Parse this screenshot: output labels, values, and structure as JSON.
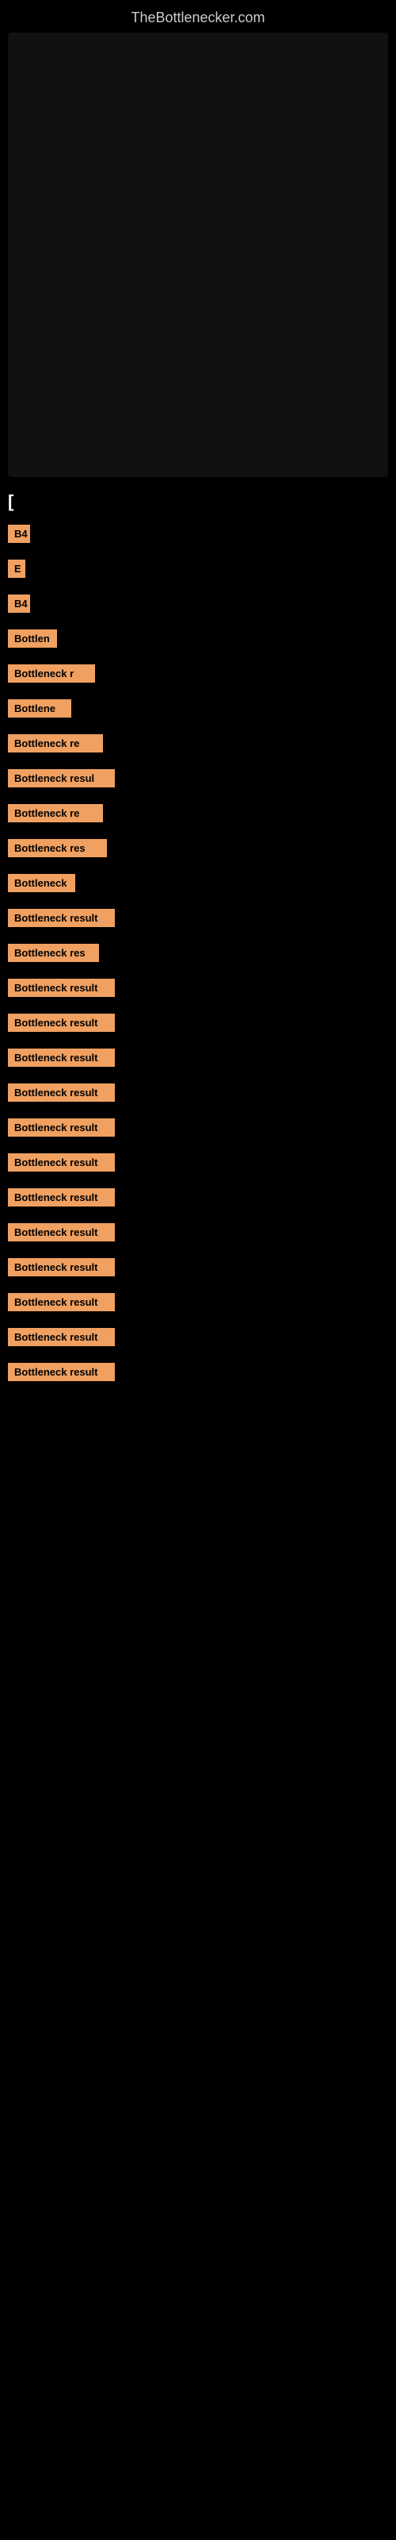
{
  "site": {
    "title": "TheBottlenecker.com"
  },
  "header": {
    "section_label": "["
  },
  "blocks": [
    {
      "id": 1,
      "label": "B4",
      "width_class": "block-1"
    },
    {
      "id": 2,
      "label": "E",
      "width_class": "block-2"
    },
    {
      "id": 3,
      "label": "B4",
      "width_class": "block-3"
    },
    {
      "id": 4,
      "label": "Bottlen",
      "width_class": "block-4"
    },
    {
      "id": 5,
      "label": "Bottleneck r",
      "width_class": "block-5"
    },
    {
      "id": 6,
      "label": "Bottlene",
      "width_class": "block-6"
    },
    {
      "id": 7,
      "label": "Bottleneck re",
      "width_class": "block-7"
    },
    {
      "id": 8,
      "label": "Bottleneck resul",
      "width_class": "block-8"
    },
    {
      "id": 9,
      "label": "Bottleneck re",
      "width_class": "block-9"
    },
    {
      "id": 10,
      "label": "Bottleneck res",
      "width_class": "block-10"
    },
    {
      "id": 11,
      "label": "Bottleneck",
      "width_class": "block-11"
    },
    {
      "id": 12,
      "label": "Bottleneck result",
      "width_class": "block-12"
    },
    {
      "id": 13,
      "label": "Bottleneck res",
      "width_class": "block-13"
    },
    {
      "id": 14,
      "label": "Bottleneck result",
      "width_class": "block-14"
    },
    {
      "id": 15,
      "label": "Bottleneck result",
      "width_class": "block-15"
    },
    {
      "id": 16,
      "label": "Bottleneck result",
      "width_class": "block-16"
    },
    {
      "id": 17,
      "label": "Bottleneck result",
      "width_class": "block-17"
    },
    {
      "id": 18,
      "label": "Bottleneck result",
      "width_class": "block-18"
    },
    {
      "id": 19,
      "label": "Bottleneck result",
      "width_class": "block-19"
    },
    {
      "id": 20,
      "label": "Bottleneck result",
      "width_class": "block-20"
    },
    {
      "id": 21,
      "label": "Bottleneck result",
      "width_class": "block-21"
    },
    {
      "id": 22,
      "label": "Bottleneck result",
      "width_class": "block-22"
    },
    {
      "id": 23,
      "label": "Bottleneck result",
      "width_class": "block-23"
    },
    {
      "id": 24,
      "label": "Bottleneck result",
      "width_class": "block-24"
    },
    {
      "id": 25,
      "label": "Bottleneck result",
      "width_class": "block-25"
    }
  ],
  "colors": {
    "background": "#000000",
    "block_bg": "#f0a060",
    "block_text": "#000000",
    "title": "#cccccc"
  }
}
